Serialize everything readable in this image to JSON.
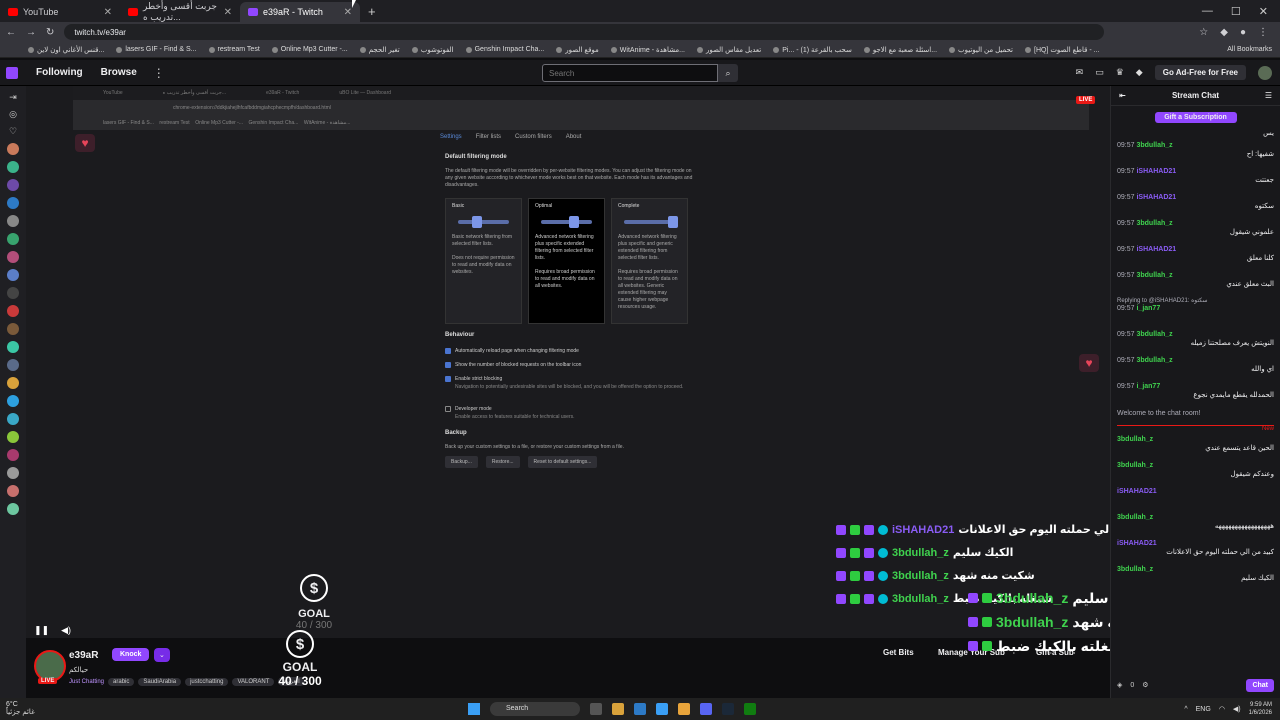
{
  "browser": {
    "tabs": [
      {
        "title": "YouTube",
        "icon": "youtube-icon"
      },
      {
        "title": "جربت أقسى وأخطر تدريب ه...",
        "icon": "youtube-icon"
      },
      {
        "title": "e39aR - Twitch",
        "icon": "twitch-icon"
      }
    ],
    "url": "twitch.tv/e39ar",
    "bookmarks": [
      "قنس الأغاني اون لاين...",
      "lasers GIF - Find & S...",
      "restream Test",
      "Online Mp3 Cutter -...",
      "تغير الحجم",
      "الفوتوشوب",
      "Genshin Impact Cha...",
      "موقع الصور",
      "WitAnime - مشاهدة...",
      "تعديل مقاس الصور",
      "Pi... - سحب بالقرعة (1)",
      "اسئلة صعبة مع الاجو...",
      "تحميل من اليوتيوب",
      "[HQ] قاطع الصوت - ..."
    ],
    "all_bookmarks": "All Bookmarks"
  },
  "topnav": {
    "following": "Following",
    "browse": "Browse",
    "search_placeholder": "Search",
    "ad_free": "Go Ad-Free for Free"
  },
  "video": {
    "live": "LIVE",
    "inner_tabs": [
      "YouTube",
      "جربت أقسى وأخطر تدريب ه...",
      "e39aR - Twitch",
      "uBO Lite — Dashboard"
    ],
    "inner_url": "chrome-extension://ddkjiahejlhfcafbddmgiahcphecmpfh/dashboard.html",
    "ublock": {
      "tabs": [
        "Settings",
        "Filter lists",
        "Custom filters",
        "About"
      ],
      "default_heading": "Default filtering mode",
      "default_desc": "The default filtering mode will be overridden by per-website filtering modes. You can adjust the filtering mode on any given website according to whichever mode works best on that website. Each mode has its advantages and disadvantages.",
      "modes": [
        {
          "title": "Basic",
          "desc": "Basic network filtering from selected filter lists.",
          "desc2": "Does not require permission to read and modify data on websites."
        },
        {
          "title": "Optimal",
          "desc": "Advanced network filtering plus specific extended filtering from selected filter lists.",
          "desc2": "Requires broad permission to read and modify data on all websites."
        },
        {
          "title": "Complete",
          "desc": "Advanced network filtering plus specific and generic extended filtering from selected filter lists.",
          "desc2": "Requires broad permission to read and modify data on all websites. Generic extended filtering may cause higher webpage resources usage."
        }
      ],
      "behaviour_heading": "Behaviour",
      "opt1": "Automatically reload page when changing filtering mode",
      "opt2": "Show the number of blocked requests on the toolbar icon",
      "opt3": "Enable strict blocking",
      "opt3_desc": "Navigation to potentially undesirable sites will be blocked, and you will be offered the option to proceed.",
      "opt4": "Developer mode",
      "opt4_desc": "Enable access to features suitable for technical users.",
      "backup_heading": "Backup",
      "backup_desc": "Back up your custom settings to a file, or restore your custom settings from a file.",
      "btn_backup": "Backup...",
      "btn_restore": "Restore...",
      "btn_reset": "Reset to default settings..."
    },
    "overlay_chat": [
      {
        "name": "iSHAHAD21",
        "text": "ید من الي حملته اليوم حق الاعلانات"
      },
      {
        "name": "3bdullah_z",
        "text": "الكيك سليم"
      },
      {
        "name": "3bdullah_z",
        "text": "شكيت منه شهد"
      },
      {
        "name": "3bdullah_z",
        "text": "شتغله بالكيك ضبط"
      }
    ],
    "goal_label": "GOAL",
    "goal_value": "40 / 300",
    "goal_symbol": "$"
  },
  "info": {
    "channel": "e39aR",
    "live": "LIVE",
    "knock": "Knock",
    "title": "حيالكم",
    "category": "Just Chatting",
    "tags": [
      "arabic",
      "SaudiArabia",
      "justcchatting",
      "VALORANT",
      "العربية"
    ],
    "get_bits": "Get Bits",
    "manage_sub": "Manage Your Sub",
    "gift_sub": "Gift a Sub",
    "goal_label": "GOAL",
    "goal_value": "40 / 300",
    "overlay": [
      {
        "name": "3bdullah_z",
        "text": "الكيك سليم"
      },
      {
        "name": "3bdullah_z",
        "text": "شكيت منه شهد"
      },
      {
        "name": "3bdullah_z",
        "text": "النويتش طلع بغار يوم شغلته بالكيك ضبط"
      }
    ]
  },
  "chat": {
    "title": "Stream Chat",
    "gift_sub": "Gift a Subscription",
    "messages": [
      {
        "ts": "",
        "name": "",
        "text": "يس",
        "color": "#efeff1"
      },
      {
        "ts": "09:57",
        "name": "3bdullah_z",
        "text": "شفيها: اح",
        "color": "#3fd24e"
      },
      {
        "ts": "09:57",
        "name": "iSHAHAD21",
        "text": "جعتتت",
        "color": "#8a5cf5"
      },
      {
        "ts": "09:57",
        "name": "iSHAHAD21",
        "text": "سكتوه",
        "color": "#8a5cf5"
      },
      {
        "ts": "09:57",
        "name": "3bdullah_z",
        "text": "علموني شيقول",
        "color": "#3fd24e"
      },
      {
        "ts": "09:57",
        "name": "iSHAHAD21",
        "text": "كلنا معلق",
        "color": "#8a5cf5"
      },
      {
        "ts": "09:57",
        "name": "3bdullah_z",
        "text": "البث معلق عندي",
        "color": "#3fd24e"
      }
    ],
    "reply_to": "Replying to @iSHAHAD21: سكتوه",
    "messages2": [
      {
        "ts": "09:57",
        "name": "i_jan77",
        "text": "",
        "color": "#3fd24e"
      },
      {
        "ts": "09:57",
        "name": "3bdullah_z",
        "text": "النويتش يعرف مصلحتنا زميله",
        "color": "#3fd24e"
      },
      {
        "ts": "09:57",
        "name": "3bdullah_z",
        "text": "اي والله",
        "color": "#3fd24e"
      },
      {
        "ts": "09:57",
        "name": "i_jan77",
        "text": "الحمدلله يقطع مايمدي نجوع",
        "color": "#efeff1"
      }
    ],
    "welcome": "Welcome to the chat room!",
    "new_label": "New",
    "messages3": [
      {
        "ts": "",
        "name": "3bdullah_z",
        "text": "الحين قاعد يتسمع عندي",
        "color": "#3fd24e"
      },
      {
        "ts": "",
        "name": "3bdullah_z",
        "text": "وعندكم شيقول",
        "color": "#3fd24e"
      },
      {
        "ts": "",
        "name": "iSHAHAD21",
        "text": "",
        "color": "#8a5cf5"
      },
      {
        "ts": "",
        "name": "3bdullah_z",
        "text": "هههههههههههههههههه",
        "color": "#3fd24e"
      },
      {
        "ts": "",
        "name": "iSHAHAD21",
        "text": "كبيد من الي حملته اليوم حق الاعلانات",
        "color": "#8a5cf5"
      },
      {
        "ts": "",
        "name": "3bdullah_z",
        "text": "الكيك سليم",
        "color": "#3fd24e"
      },
      {
        "ts": "",
        "name": "3bdullah_z",
        "text": "شكيت منه شهد",
        "color": "#3fd24e"
      },
      {
        "ts": "",
        "name": "3bdullah_z",
        "text": "النويتش طلع",
        "color": "#3fd24e"
      }
    ],
    "points": "0",
    "chat_button": "Chat"
  },
  "taskbar": {
    "temp": "6°C",
    "weather": "غائم جزئياً",
    "search": "Search",
    "lang": "ENG",
    "time": "9:59 AM",
    "date": "1/6/2026"
  }
}
